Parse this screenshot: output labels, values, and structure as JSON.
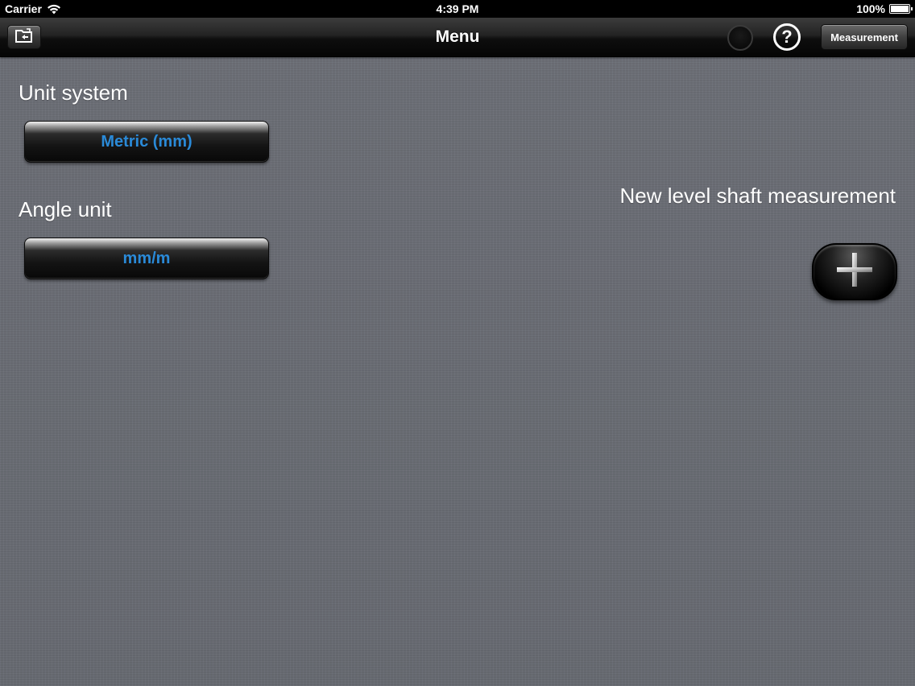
{
  "status_bar": {
    "carrier": "Carrier",
    "time": "4:39 PM",
    "battery": "100%"
  },
  "nav_bar": {
    "title": "Menu",
    "measurement_button": "Measurement",
    "help_label": "?",
    "icons": {
      "left": "folder-icon",
      "activity": "spinner-icon",
      "help": "question-icon"
    }
  },
  "unit_system": {
    "label": "Unit system",
    "value": "Metric (mm)"
  },
  "angle_unit": {
    "label": "Angle unit",
    "value": "mm/m"
  },
  "new_measurement": {
    "label": "New level shaft measurement",
    "icon": "plus-icon"
  },
  "colors": {
    "accent": "#2a8ad8",
    "background": "#6b6e76"
  }
}
